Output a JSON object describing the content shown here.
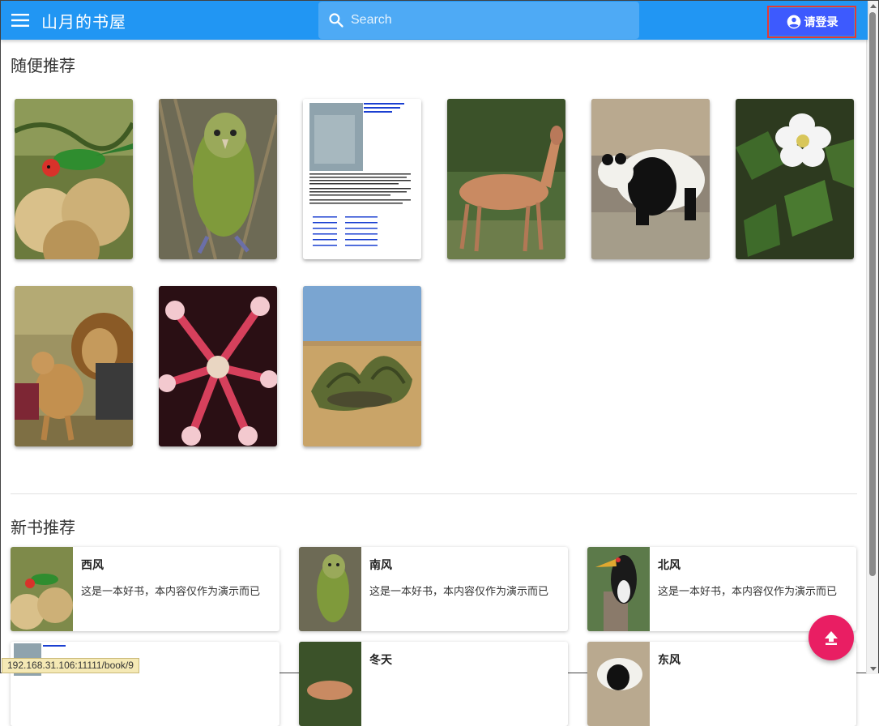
{
  "app": {
    "title": "山月的书屋"
  },
  "search": {
    "placeholder": "Search"
  },
  "login": {
    "label": "请登录"
  },
  "sections": {
    "random": {
      "title": "随便推荐"
    },
    "new": {
      "title": "新书推荐"
    }
  },
  "random_covers": [
    {
      "name": "cover-bird-lorikeet",
      "icon": "bird-on-flowers"
    },
    {
      "name": "cover-kakapo",
      "icon": "green-parrot"
    },
    {
      "name": "cover-document",
      "icon": "document-page"
    },
    {
      "name": "cover-deer",
      "icon": "deer"
    },
    {
      "name": "cover-panda",
      "icon": "panda"
    },
    {
      "name": "cover-white-flower",
      "icon": "flower"
    },
    {
      "name": "cover-lions",
      "icon": "lion"
    },
    {
      "name": "cover-sundew",
      "icon": "sundew-plant"
    },
    {
      "name": "cover-welwitschia",
      "icon": "desert-plant"
    }
  ],
  "new_books": [
    {
      "name": "西风",
      "desc": "这是一本好书，本内容仅作为演示而已"
    },
    {
      "name": "南风",
      "desc": "这是一本好书，本内容仅作为演示而已"
    },
    {
      "name": "北风",
      "desc": "这是一本好书，本内容仅作为演示而已"
    },
    {
      "name": "",
      "desc": ""
    },
    {
      "name": "冬天",
      "desc": ""
    },
    {
      "name": "东风",
      "desc": ""
    }
  ],
  "status_url": "192.168.31.106:11111/book/9",
  "colors": {
    "appbar": "#2196f3",
    "login": "#3d5afe",
    "fab": "#e91e63"
  }
}
